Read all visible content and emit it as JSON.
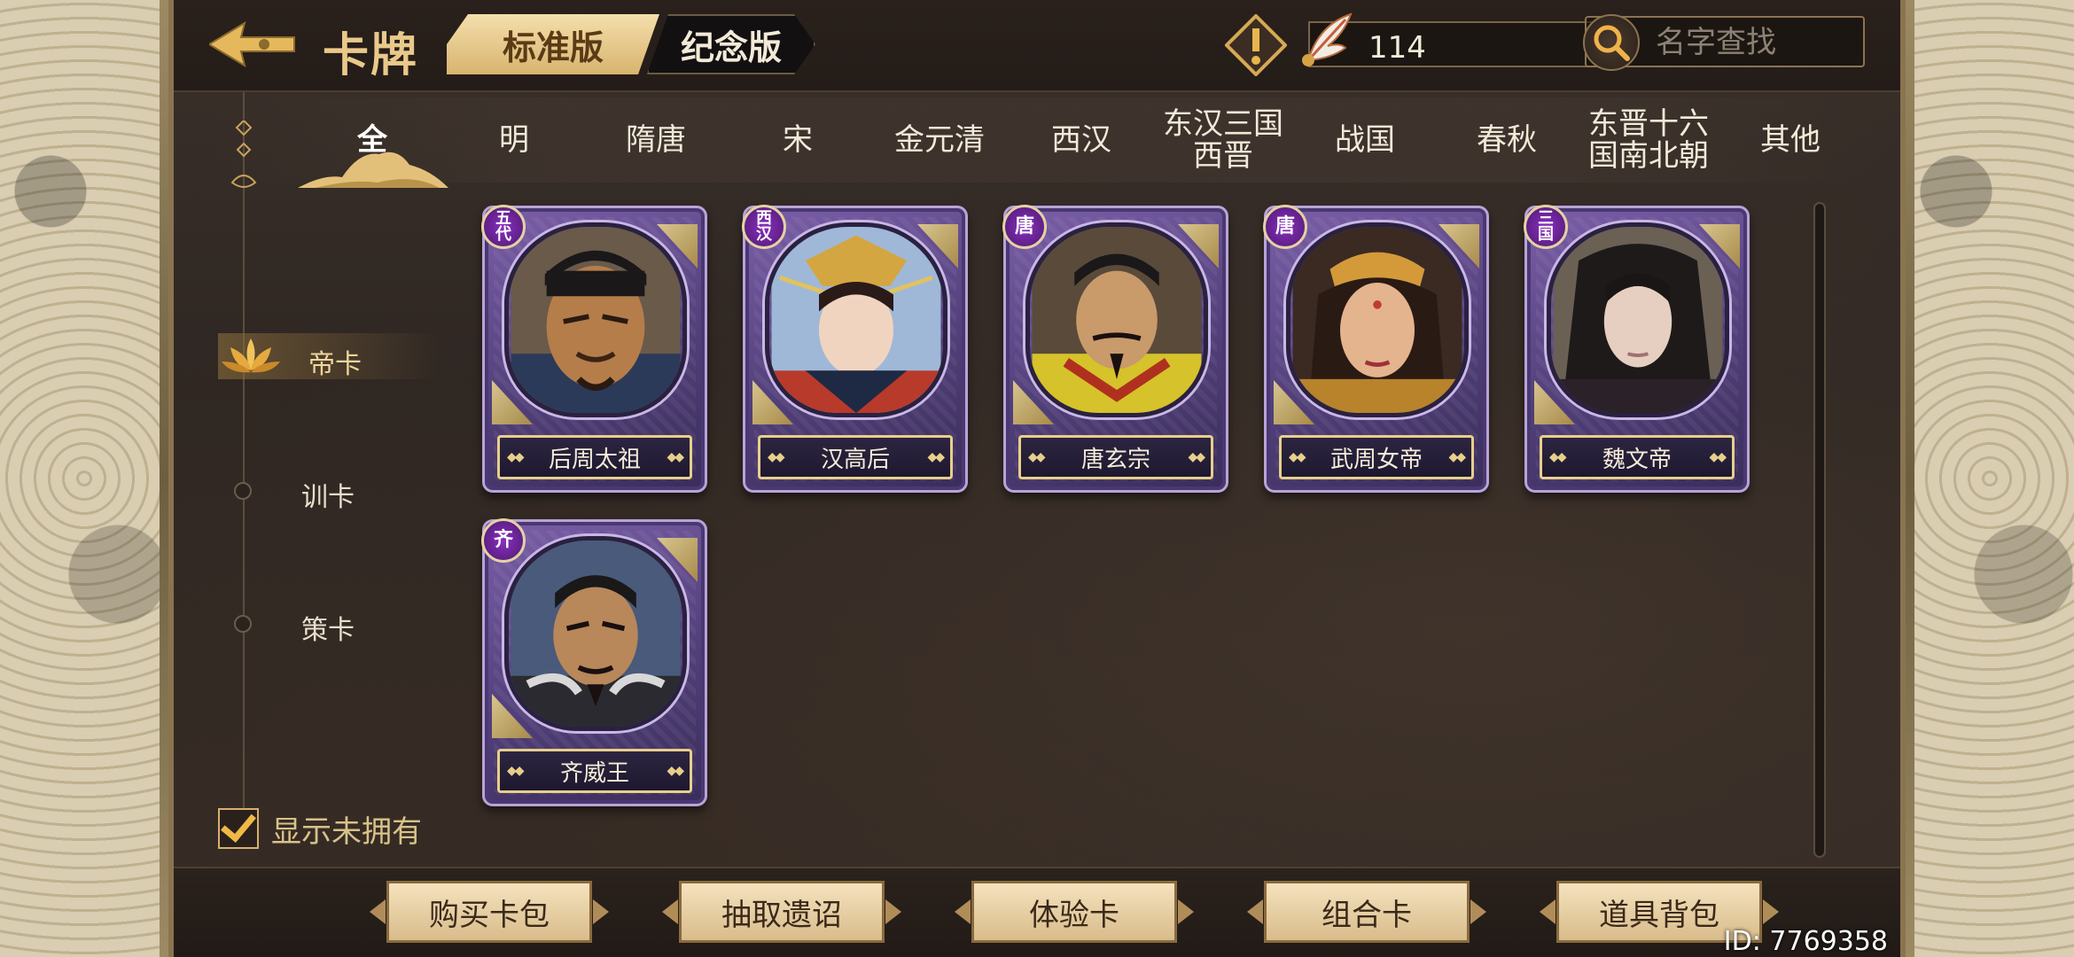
{
  "header": {
    "title": "卡牌",
    "edition_tabs": [
      {
        "label": "标准版",
        "active": true
      },
      {
        "label": "纪念版",
        "active": false
      }
    ],
    "currency_value": "114",
    "search_placeholder": "名字查找"
  },
  "dynasty_tabs": [
    {
      "label": "全",
      "active": true
    },
    {
      "label": "明"
    },
    {
      "label": "隋唐"
    },
    {
      "label": "宋"
    },
    {
      "label": "金元清"
    },
    {
      "label": "西汉"
    },
    {
      "label": "东汉三国\n西晋"
    },
    {
      "label": "战国"
    },
    {
      "label": "春秋"
    },
    {
      "label": "东晋十六\n国南北朝"
    },
    {
      "label": "其他"
    }
  ],
  "categories": [
    {
      "label": "帝卡",
      "active": true
    },
    {
      "label": "训卡"
    },
    {
      "label": "策卡"
    }
  ],
  "cards": [
    {
      "name": "后周太祖",
      "badge": "五\n代"
    },
    {
      "name": "汉高后",
      "badge": "西\n汉"
    },
    {
      "name": "唐玄宗",
      "badge": "唐"
    },
    {
      "name": "武周女帝",
      "badge": "唐"
    },
    {
      "name": "魏文帝",
      "badge": "三\n国"
    },
    {
      "name": "齐威王",
      "badge": "齐"
    }
  ],
  "show_not_owned": {
    "label": "显示未拥有",
    "checked": true
  },
  "bottom_buttons": [
    "购买卡包",
    "抽取遗诏",
    "体验卡",
    "组合卡",
    "道具背包"
  ],
  "player_id": "ID: 7769358",
  "colors": {
    "gold": "#e9c98a",
    "card_purple": "#52407a",
    "button_cream": "#f5e2bd"
  }
}
